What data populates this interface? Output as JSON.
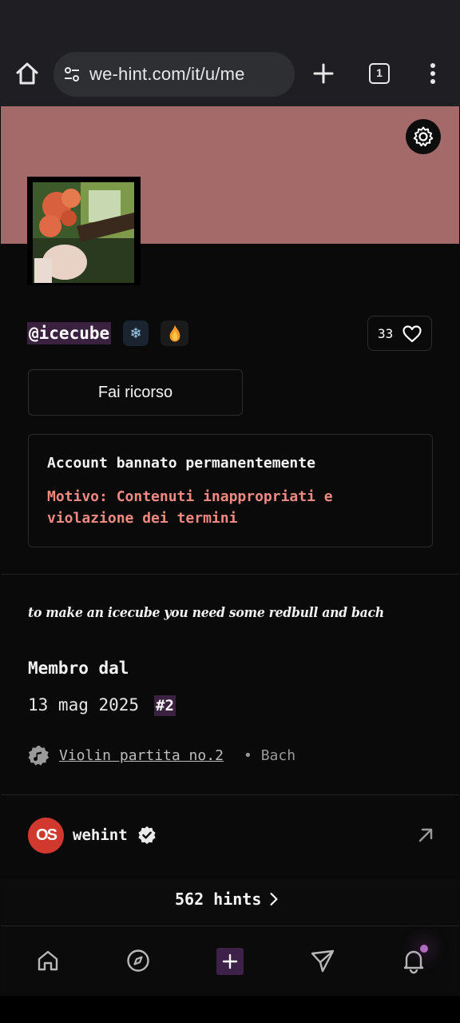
{
  "browser": {
    "url": "we-hint.com/it/u/me",
    "tab_count": "1"
  },
  "profile": {
    "username": "@icecube",
    "badge_snow": "❄",
    "likes_count": "33",
    "appeal_button": "Fai ricorso",
    "ban": {
      "title": "Account bannato permanentemente",
      "reason": "Motivo: Contenuti inappropriati e violazione dei termini"
    },
    "bio": "to make an icecube you need some redbull and bach",
    "member_label": "Membro dal",
    "member_date": "13 mag 2025",
    "member_rank": "#2",
    "music": {
      "track": "Violin partita no.2",
      "separator": "•",
      "artist": "Bach"
    },
    "lastfm": {
      "logo_text": "OS",
      "name": "wehint"
    },
    "hints": "562 hints"
  },
  "nav": [
    "home-icon",
    "compass-icon",
    "plus-icon",
    "send-icon",
    "bell-icon"
  ],
  "colors": {
    "banner": "#a46a6a",
    "accent_purple": "#3a2140",
    "ban_reason": "#ef8a82",
    "lastfm_red": "#d1392f"
  }
}
